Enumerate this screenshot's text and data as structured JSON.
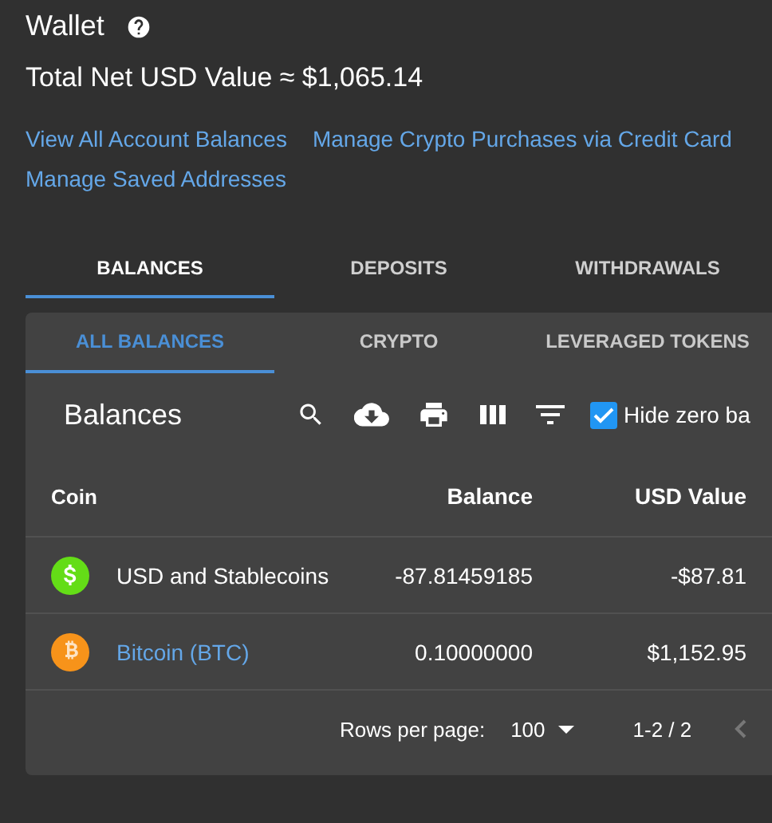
{
  "header": {
    "title": "Wallet",
    "total": "Total Net USD Value ≈ $1,065.14"
  },
  "links": [
    "View All Account Balances",
    "Manage Crypto Purchases via Credit Card",
    "Manage Saved Addresses"
  ],
  "tabs": [
    {
      "label": "BALANCES",
      "selected": true
    },
    {
      "label": "DEPOSITS",
      "selected": false
    },
    {
      "label": "WITHDRAWALS",
      "selected": false
    }
  ],
  "subtabs": [
    {
      "label": "ALL BALANCES",
      "selected": true
    },
    {
      "label": "CRYPTO",
      "selected": false
    },
    {
      "label": "LEVERAGED TOKENS",
      "selected": false
    }
  ],
  "toolbar": {
    "title": "Balances",
    "tools": [
      {
        "kind": "search"
      },
      {
        "kind": "download"
      },
      {
        "kind": "print"
      },
      {
        "kind": "columns"
      },
      {
        "kind": "filter"
      }
    ],
    "hide_zero": {
      "label": "Hide zero ba",
      "checked": true
    }
  },
  "table": {
    "columns": [
      "Coin",
      "Balance",
      "USD Value"
    ],
    "rows": [
      {
        "coin": "USD and Stablecoins",
        "kind": "dollar",
        "color": "#64dd17",
        "linked": false,
        "balance": "-87.81459185",
        "usd": "-$87.81"
      },
      {
        "coin": "Bitcoin (BTC)",
        "kind": "bitcoin",
        "color": "#f7931a",
        "linked": true,
        "balance": "0.10000000",
        "usd": "$1,152.95"
      }
    ]
  },
  "pagination": {
    "label": "Rows per page:",
    "per_page": "100",
    "range": "1-2 / 2"
  }
}
